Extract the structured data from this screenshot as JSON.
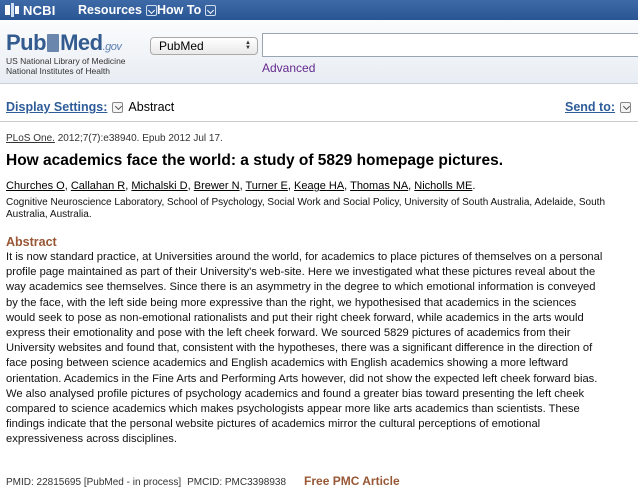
{
  "topbar": {
    "brand": "NCBI",
    "menus": [
      {
        "label": "Resources"
      },
      {
        "label": "How To"
      }
    ]
  },
  "header": {
    "logo_pub": "Pub",
    "logo_med": "Med",
    "logo_gov": ".gov",
    "nlm_line1": "US National Library of Medicine",
    "nlm_line2": "National Institutes of Health",
    "database": "PubMed",
    "search_value": "",
    "advanced": "Advanced"
  },
  "display": {
    "settings_label": "Display Settings:",
    "mode": "Abstract",
    "send_to": "Send to:"
  },
  "article": {
    "journal": "PLoS One.",
    "citation_rest": " 2012;7(7):e38940. Epub 2012 Jul 17.",
    "title": "How academics face the world: a study of 5829 homepage pictures.",
    "authors": [
      "Churches O",
      "Callahan R",
      "Michalski D",
      "Brewer N",
      "Turner E",
      "Keage HA",
      "Thomas NA",
      "Nicholls ME"
    ],
    "affiliation": "Cognitive Neuroscience Laboratory, School of Psychology, Social Work and Social Policy, University of South Australia, Adelaide, South Australia, Australia.",
    "abstract_heading": "Abstract",
    "abstract_lines": [
      "It is now standard practice, at Universities around the world, for academics to place pictures of themselves on a personal",
      "profile page maintained as part of their University's web-site. Here we investigated what these pictures reveal about the",
      "way academics see themselves. Since there is an asymmetry in the degree to which emotional information is conveyed",
      "by the face, with the left side being more expressive than the right, we hypothesised that academics in the sciences",
      "would seek to pose as non-emotional rationalists and put their right cheek forward, while academics in the arts would",
      "express their emotionality and pose with the left cheek forward. We sourced 5829 pictures of academics from their",
      "University websites and found that, consistent with the hypotheses, there was a significant difference in the direction of",
      "face posing between science academics and English academics with English academics showing a more leftward",
      "orientation. Academics in the Fine Arts and Performing Arts however, did not show the expected left cheek forward bias.",
      "We also analysed profile pictures of psychology academics and found a greater bias toward presenting the left cheek",
      "compared to science academics which makes psychologists appear more like arts academics than scientists. These",
      "findings indicate that the personal website pictures of academics mirror the cultural perceptions of emotional",
      "expressiveness across disciplines."
    ],
    "pmid": "PMID: 22815695 [PubMed - in process]",
    "pmcid": "PMCID: PMC3398938",
    "free_pmc": "Free PMC Article"
  },
  "colors": {
    "topbar": "#2f5b99",
    "link": "#2e5c99",
    "abstract_heading": "#985735",
    "advanced_link": "#642a8f"
  }
}
